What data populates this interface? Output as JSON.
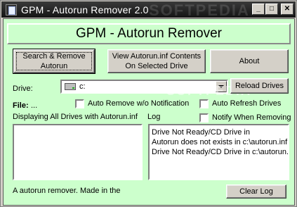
{
  "window": {
    "title": "GPM - Autorun Remover 2.0",
    "minimize_glyph": "_",
    "maximize_glyph": "□",
    "close_glyph": "✕",
    "watermark": "SOFTPEDIA"
  },
  "header": {
    "title": "GPM - Autorun Remover"
  },
  "buttons": {
    "scan_remove": {
      "line1": "Search & Remove",
      "line2": "Autorun"
    },
    "view_contents": {
      "line1": "View Autorun.inf Contents",
      "line2": "On Selected Drive"
    },
    "about": "About",
    "reload_drives": "Reload Drives",
    "clear_log": "Clear Log"
  },
  "drive": {
    "label": "Drive:",
    "value": "c:",
    "icon": "hard-drive-icon"
  },
  "file": {
    "label": "File:",
    "value": "..."
  },
  "options": {
    "auto_remove": {
      "label": "Auto Remove w/o Notification",
      "checked": false
    },
    "auto_refresh": {
      "label": "Auto Refresh Drives",
      "checked": false
    },
    "notify": {
      "label": "Notify When Removing",
      "checked": false
    }
  },
  "drives_list": {
    "label": "Displaying All Drives with Autorun.inf",
    "items": []
  },
  "log": {
    "label": "Log",
    "lines": [
      "Drive Not Ready/CD Drive  in",
      "Autorun does not exists in c:\\autorun.inf",
      "Drive Not Ready/CD Drive  in c:\\autorun.i"
    ]
  },
  "footer": {
    "text": "A autorun remover. Made in the"
  },
  "colors": {
    "client_bg": "#ccffcc",
    "titlebar": "#1e1e1e"
  }
}
